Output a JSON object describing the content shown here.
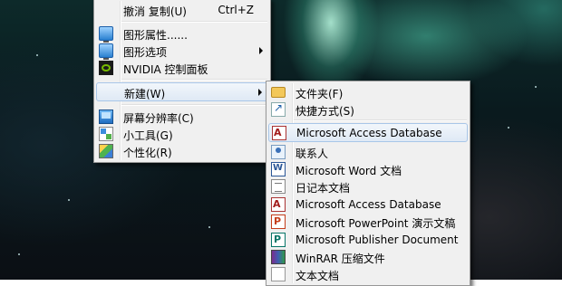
{
  "context_menu": {
    "items": [
      {
        "label": "撤消 复制(U)",
        "shortcut": "Ctrl+Z",
        "icon": ""
      },
      {
        "label": "图形属性......",
        "icon": "monitor-icon"
      },
      {
        "label": "图形选项",
        "icon": "monitor-icon"
      },
      {
        "label": "NVIDIA 控制面板",
        "icon": "nvidia-icon"
      },
      {
        "label": "新建(W)",
        "icon": ""
      },
      {
        "label": "屏幕分辨率(C)",
        "icon": "screen-resolution-icon"
      },
      {
        "label": "小工具(G)",
        "icon": "gadgets-icon"
      },
      {
        "label": "个性化(R)",
        "icon": "personalize-icon"
      }
    ]
  },
  "new_submenu": {
    "items": [
      {
        "label": "文件夹(F)",
        "icon": "folder-icon"
      },
      {
        "label": "快捷方式(S)",
        "icon": "shortcut-icon"
      },
      {
        "label": "Microsoft Access Database",
        "icon": "access-icon"
      },
      {
        "label": "联系人",
        "icon": "contact-icon"
      },
      {
        "label": "Microsoft Word 文档",
        "icon": "word-icon"
      },
      {
        "label": "日记本文档",
        "icon": "journal-icon"
      },
      {
        "label": "Microsoft Access Database",
        "icon": "access-icon"
      },
      {
        "label": "Microsoft PowerPoint 演示文稿",
        "icon": "powerpoint-icon"
      },
      {
        "label": "Microsoft Publisher Document",
        "icon": "publisher-icon"
      },
      {
        "label": "WinRAR 压缩文件",
        "icon": "winrar-icon"
      },
      {
        "label": "文本文档",
        "icon": "text-document-icon"
      }
    ]
  }
}
